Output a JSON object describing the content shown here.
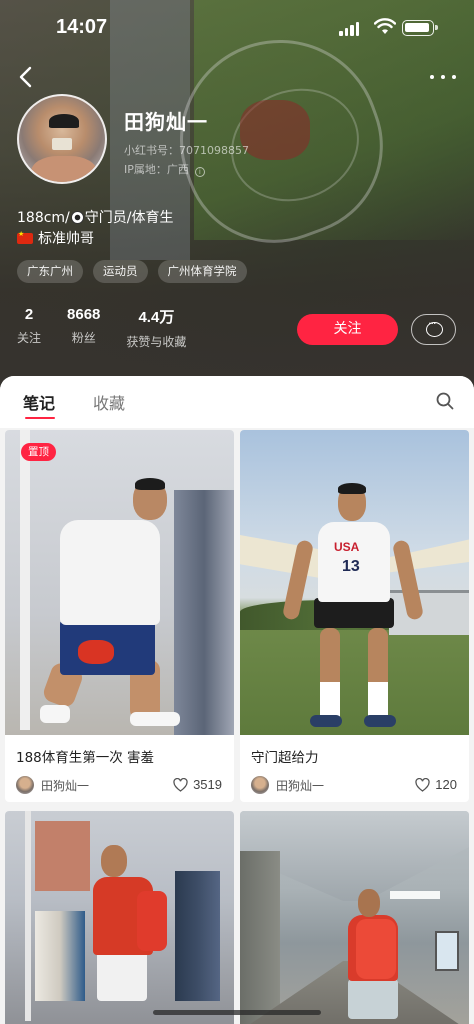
{
  "status_bar": {
    "time": "14:07"
  },
  "profile": {
    "username": "田狗灿一",
    "redbook_id": "小红书号：7071098857",
    "ip_location": "IP属地：广西",
    "bio_line1_a": "188cm/",
    "bio_line1_b": "守门员/体育生",
    "bio_line2": "标准帅哥",
    "tags": [
      "广东广州",
      "运动员",
      "广州体育学院"
    ],
    "stats": [
      {
        "value": "2",
        "label": "关注"
      },
      {
        "value": "8668",
        "label": "粉丝"
      },
      {
        "value": "4.4万",
        "label": "获赞与收藏"
      }
    ],
    "follow_label": "关注"
  },
  "tabs": {
    "notes": "笔记",
    "collect": "收藏"
  },
  "notes": [
    {
      "title": "188体育生第一次 害羞",
      "author": "田狗灿一",
      "likes": "3519",
      "pinned_label": "置顶"
    },
    {
      "title": "守门超给力",
      "author": "田狗灿一",
      "likes": "120"
    },
    {
      "title": "",
      "author": "",
      "likes": ""
    },
    {
      "title": "",
      "author": "",
      "likes": ""
    }
  ],
  "icons": {
    "back": "chevron-left-icon",
    "more": "more-dots-icon",
    "message": "chat-bubble-icon",
    "search": "search-icon",
    "like": "heart-icon"
  },
  "colors": {
    "accent": "#ff2442",
    "header_bg": "#36332f",
    "page_bg": "#f3f3f3"
  }
}
